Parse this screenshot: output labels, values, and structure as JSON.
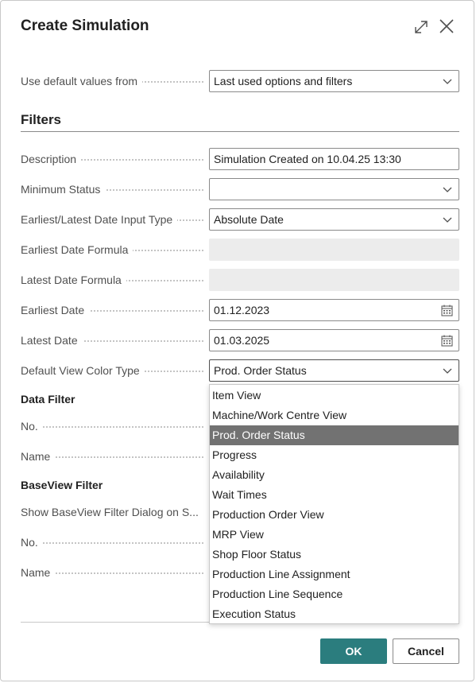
{
  "dialog": {
    "title": "Create Simulation",
    "expand_icon": "expand-icon",
    "close_icon": "close-icon"
  },
  "defaults": {
    "label": "Use default values from",
    "value": "Last used options and filters"
  },
  "filters": {
    "section_title": "Filters",
    "description": {
      "label": "Description",
      "value": "Simulation Created on 10.04.25 13:30"
    },
    "minimum_status": {
      "label": "Minimum Status",
      "value": ""
    },
    "date_input_type": {
      "label": "Earliest/Latest Date Input Type",
      "value": "Absolute Date"
    },
    "earliest_date_formula": {
      "label": "Earliest Date Formula",
      "value": ""
    },
    "latest_date_formula": {
      "label": "Latest Date Formula",
      "value": ""
    },
    "earliest_date": {
      "label": "Earliest Date",
      "value": "01.12.2023"
    },
    "latest_date": {
      "label": "Latest Date",
      "value": "01.03.2025"
    },
    "default_view_color_type": {
      "label": "Default View Color Type",
      "value": "Prod. Order Status"
    }
  },
  "data_filter": {
    "title": "Data Filter",
    "no_label": "No.",
    "name_label": "Name"
  },
  "baseview_filter": {
    "title": "BaseView Filter",
    "show_dialog_label": "Show BaseView Filter Dialog on S...",
    "no_label": "No.",
    "name_label": "Name"
  },
  "dropdown": {
    "options": [
      "Item View",
      "Machine/Work Centre View",
      "Prod. Order Status",
      "Progress",
      "Availability",
      "Wait Times",
      "Production Order View",
      "MRP View",
      "Shop Floor Status",
      "Production Line Assignment",
      "Production Line Sequence",
      "Execution Status"
    ],
    "selected": "Prod. Order Status"
  },
  "buttons": {
    "ok": "OK",
    "cancel": "Cancel"
  },
  "colors": {
    "accent": "#2b7d7e",
    "selected_option": "#727272"
  }
}
